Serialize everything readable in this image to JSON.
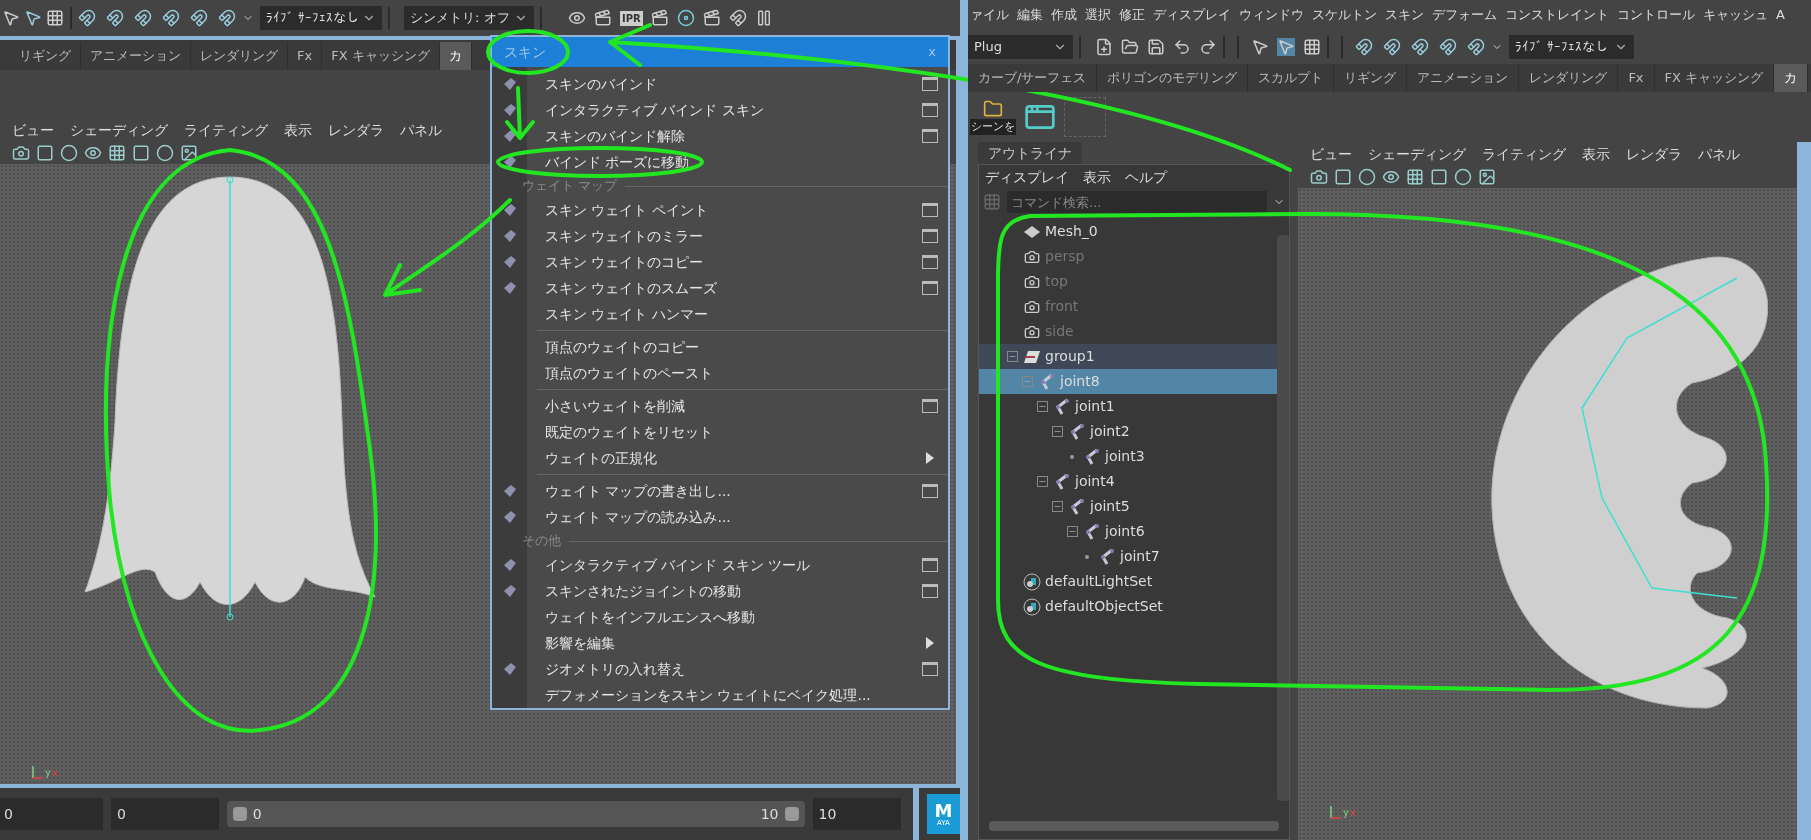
{
  "left_window": {
    "toolbar": {
      "surface_dropdown": "ﾗｲﾌﾞ ｻｰﾌｪｽなし",
      "symmetry_dropdown": "シンメトリ: オフ",
      "ipr_label": "IPR"
    },
    "tabs": [
      {
        "label": "リギング",
        "selected": false
      },
      {
        "label": "アニメーション",
        "selected": false
      },
      {
        "label": "レンダリング",
        "selected": false
      },
      {
        "label": "Fx",
        "selected": false
      },
      {
        "label": "FX キャッシング",
        "selected": false
      },
      {
        "label": "カ",
        "selected": true
      }
    ],
    "panel_menu": [
      "ビュー",
      "シェーディング",
      "ライティング",
      "表示",
      "レンダラ",
      "パネル"
    ],
    "axis_labels": [
      "y",
      "x"
    ],
    "bottom_bar": {
      "field_1": "0",
      "field_2": "0",
      "range_start": "0",
      "range_end": "10",
      "field_3": "10"
    }
  },
  "logo": {
    "letter": "M",
    "caption": "AYA"
  },
  "skin_menu": {
    "title": "スキン",
    "close": "x",
    "items": [
      {
        "kind": "item",
        "label": "スキンのバインド",
        "icon": true,
        "option_box": true,
        "submenu": false
      },
      {
        "kind": "item",
        "label": "インタラクティブ バインド スキン",
        "icon": true,
        "option_box": true,
        "submenu": false
      },
      {
        "kind": "item",
        "label": "スキンのバインド解除",
        "icon": true,
        "option_box": true,
        "submenu": false
      },
      {
        "kind": "item",
        "label": "バインド ポーズに移動",
        "icon": true,
        "option_box": false,
        "submenu": false
      },
      {
        "kind": "section",
        "label": "ウェイト マップ"
      },
      {
        "kind": "item",
        "label": "スキン ウェイト ペイント",
        "icon": true,
        "option_box": true,
        "submenu": false
      },
      {
        "kind": "item",
        "label": "スキン ウェイトのミラー",
        "icon": true,
        "option_box": true,
        "submenu": false
      },
      {
        "kind": "item",
        "label": "スキン ウェイトのコピー",
        "icon": true,
        "option_box": true,
        "submenu": false
      },
      {
        "kind": "item",
        "label": "スキン ウェイトのスムーズ",
        "icon": true,
        "option_box": true,
        "submenu": false
      },
      {
        "kind": "item",
        "label": "スキン ウェイト ハンマー",
        "icon": false,
        "option_box": false,
        "submenu": false
      },
      {
        "kind": "divider"
      },
      {
        "kind": "item",
        "label": "頂点のウェイトのコピー",
        "icon": false,
        "option_box": false,
        "submenu": false
      },
      {
        "kind": "item",
        "label": "頂点のウェイトのペースト",
        "icon": false,
        "option_box": false,
        "submenu": false
      },
      {
        "kind": "divider"
      },
      {
        "kind": "item",
        "label": "小さいウェイトを削減",
        "icon": false,
        "option_box": true,
        "submenu": false
      },
      {
        "kind": "item",
        "label": "既定のウェイトをリセット",
        "icon": false,
        "option_box": false,
        "submenu": false
      },
      {
        "kind": "item",
        "label": "ウェイトの正規化",
        "icon": false,
        "option_box": false,
        "submenu": true
      },
      {
        "kind": "divider"
      },
      {
        "kind": "item",
        "label": "ウェイト マップの書き出し...",
        "icon": true,
        "option_box": true,
        "submenu": false
      },
      {
        "kind": "item",
        "label": "ウェイト マップの読み込み...",
        "icon": true,
        "option_box": false,
        "submenu": false
      },
      {
        "kind": "section",
        "label": "その他"
      },
      {
        "kind": "item",
        "label": "インタラクティブ バインド スキン ツール",
        "icon": true,
        "option_box": true,
        "submenu": false
      },
      {
        "kind": "item",
        "label": "スキンされたジョイントの移動",
        "icon": true,
        "option_box": true,
        "submenu": false
      },
      {
        "kind": "item",
        "label": "ウェイトをインフルエンスへ移動",
        "icon": false,
        "option_box": false,
        "submenu": false
      },
      {
        "kind": "item",
        "label": "影響を編集",
        "icon": false,
        "option_box": false,
        "submenu": true
      },
      {
        "kind": "item",
        "label": "ジオメトリの入れ替え",
        "icon": true,
        "option_box": true,
        "submenu": false
      },
      {
        "kind": "item",
        "label": "デフォメーションをスキン ウェイトにベイク処理...",
        "icon": false,
        "option_box": false,
        "submenu": false
      }
    ]
  },
  "right_window": {
    "menu_bar": [
      "ァイル",
      "編集",
      "作成",
      "選択",
      "修正",
      "ディスプレイ",
      "ウィンドウ",
      "スケルトン",
      "スキン",
      "デフォーム",
      "コンストレイント",
      "コントロール",
      "キャッシュ",
      "A"
    ],
    "toolbar": {
      "workspace_dropdown": "Plug",
      "surface_dropdown": "ﾗｲﾌﾞ ｻｰﾌｪｽなし"
    },
    "tabs": [
      {
        "label": "カーブ/サーフェス",
        "selected": false
      },
      {
        "label": "ポリゴンのモデリング",
        "selected": false
      },
      {
        "label": "スカルプト",
        "selected": false
      },
      {
        "label": "リギング",
        "selected": false
      },
      {
        "label": "アニメーション",
        "selected": false
      },
      {
        "label": "レンダリング",
        "selected": false
      },
      {
        "label": "Fx",
        "selected": false
      },
      {
        "label": "FX キャッシング",
        "selected": false
      },
      {
        "label": "カ",
        "selected": true
      }
    ],
    "shelf": {
      "button_label": "シーンを"
    },
    "outliner": {
      "tab": "アウトライナ",
      "menu": [
        "ディスプレイ",
        "表示",
        "ヘルプ"
      ],
      "search": {
        "placeholder": "コマンド検索..."
      },
      "tree": [
        {
          "name": "Mesh_0",
          "kind": "mesh",
          "dimmed": false,
          "selected": false
        },
        {
          "name": "persp",
          "kind": "camera",
          "dimmed": true,
          "selected": false
        },
        {
          "name": "top",
          "kind": "camera",
          "dimmed": true,
          "selected": false
        },
        {
          "name": "front",
          "kind": "camera",
          "dimmed": true,
          "selected": false
        },
        {
          "name": "side",
          "kind": "camera",
          "dimmed": true,
          "selected": false
        },
        {
          "name": "group1",
          "kind": "group",
          "dimmed": false,
          "selected": false,
          "children": [
            {
              "name": "joint8",
              "kind": "joint",
              "dimmed": false,
              "selected": true,
              "children": [
                {
                  "name": "joint1",
                  "kind": "joint",
                  "dimmed": false,
                  "selected": false,
                  "children": [
                    {
                      "name": "joint2",
                      "kind": "joint",
                      "dimmed": false,
                      "selected": false,
                      "children": [
                        {
                          "name": "joint3",
                          "kind": "joint",
                          "dimmed": false,
                          "selected": false
                        }
                      ]
                    }
                  ]
                },
                {
                  "name": "joint4",
                  "kind": "joint",
                  "dimmed": false,
                  "selected": false,
                  "children": [
                    {
                      "name": "joint5",
                      "kind": "joint",
                      "dimmed": false,
                      "selected": false,
                      "children": [
                        {
                          "name": "joint6",
                          "kind": "joint",
                          "dimmed": false,
                          "selected": false,
                          "children": [
                            {
                              "name": "joint7",
                              "kind": "joint",
                              "dimmed": false,
                              "selected": false
                            }
                          ]
                        }
                      ]
                    }
                  ]
                }
              ]
            }
          ]
        },
        {
          "name": "defaultLightSet",
          "kind": "set",
          "dimmed": false,
          "selected": false
        },
        {
          "name": "defaultObjectSet",
          "kind": "set",
          "dimmed": false,
          "selected": false
        }
      ]
    },
    "panel_menu": [
      "ビュー",
      "シェーディング",
      "ライティング",
      "表示",
      "レンダラ",
      "パネル"
    ],
    "axis_labels": [
      "y",
      "x"
    ]
  }
}
